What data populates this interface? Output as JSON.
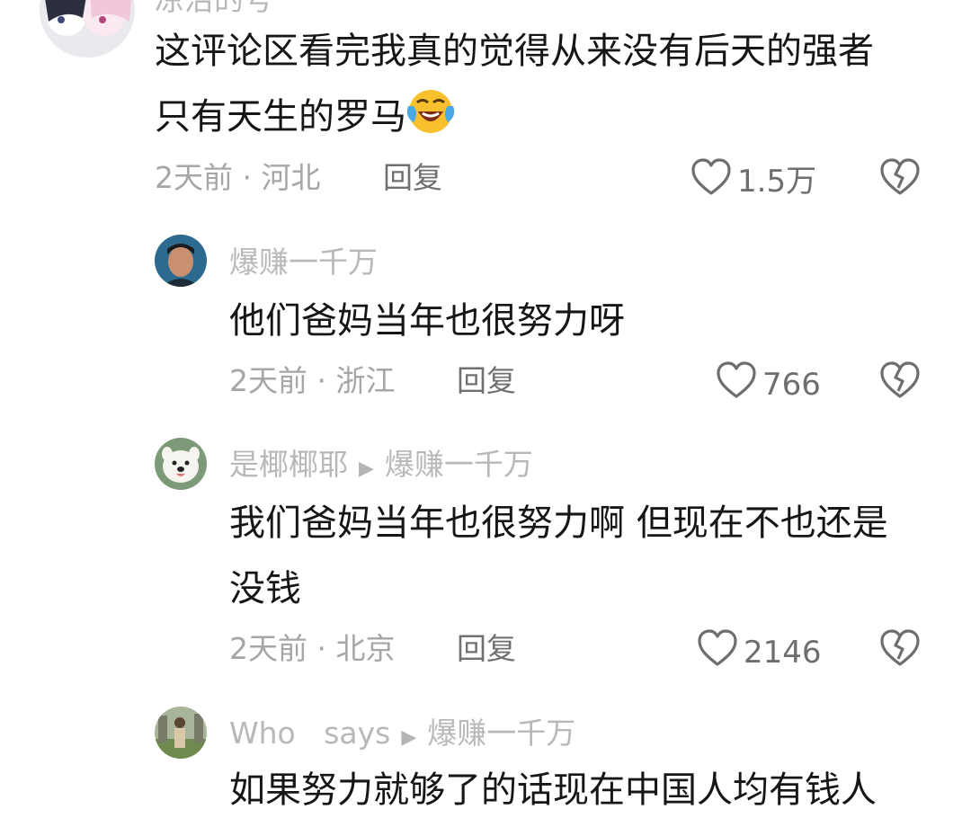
{
  "top_comment": {
    "username": "凉治的号",
    "text_line1": "这评论区看完我真的觉得从来没有后天的强者",
    "text_line2": "只有天生的罗马",
    "emoji": "laughing-crying-emoji",
    "time": "2天前",
    "separator": "·",
    "location": "河北",
    "reply_label": "回复",
    "likes": "1.5万"
  },
  "replies": [
    {
      "username": "爆赚一千万",
      "text_line1": "他们爸妈当年也很努力呀",
      "time": "2天前",
      "separator": "·",
      "location": "浙江",
      "reply_label": "回复",
      "likes": "766"
    },
    {
      "username": "是椰椰耶",
      "reply_to": "爆赚一千万",
      "text_line1": "我们爸妈当年也很努力啊 但现在不也还是",
      "text_line2": "没钱",
      "time": "2天前",
      "separator": "·",
      "location": "北京",
      "reply_label": "回复",
      "likes": "2146"
    },
    {
      "username": "Who   says",
      "reply_to": "爆赚一千万",
      "text_line1": "如果努力就够了的话现在中国人均有钱人"
    }
  ],
  "icons": {
    "like": "heart-outline-icon",
    "dislike": "broken-heart-icon",
    "reply_arrow": "play-triangle-icon"
  },
  "colors": {
    "text": "#161616",
    "muted": "#a6a6a6",
    "icon": "#6e6e6e"
  }
}
